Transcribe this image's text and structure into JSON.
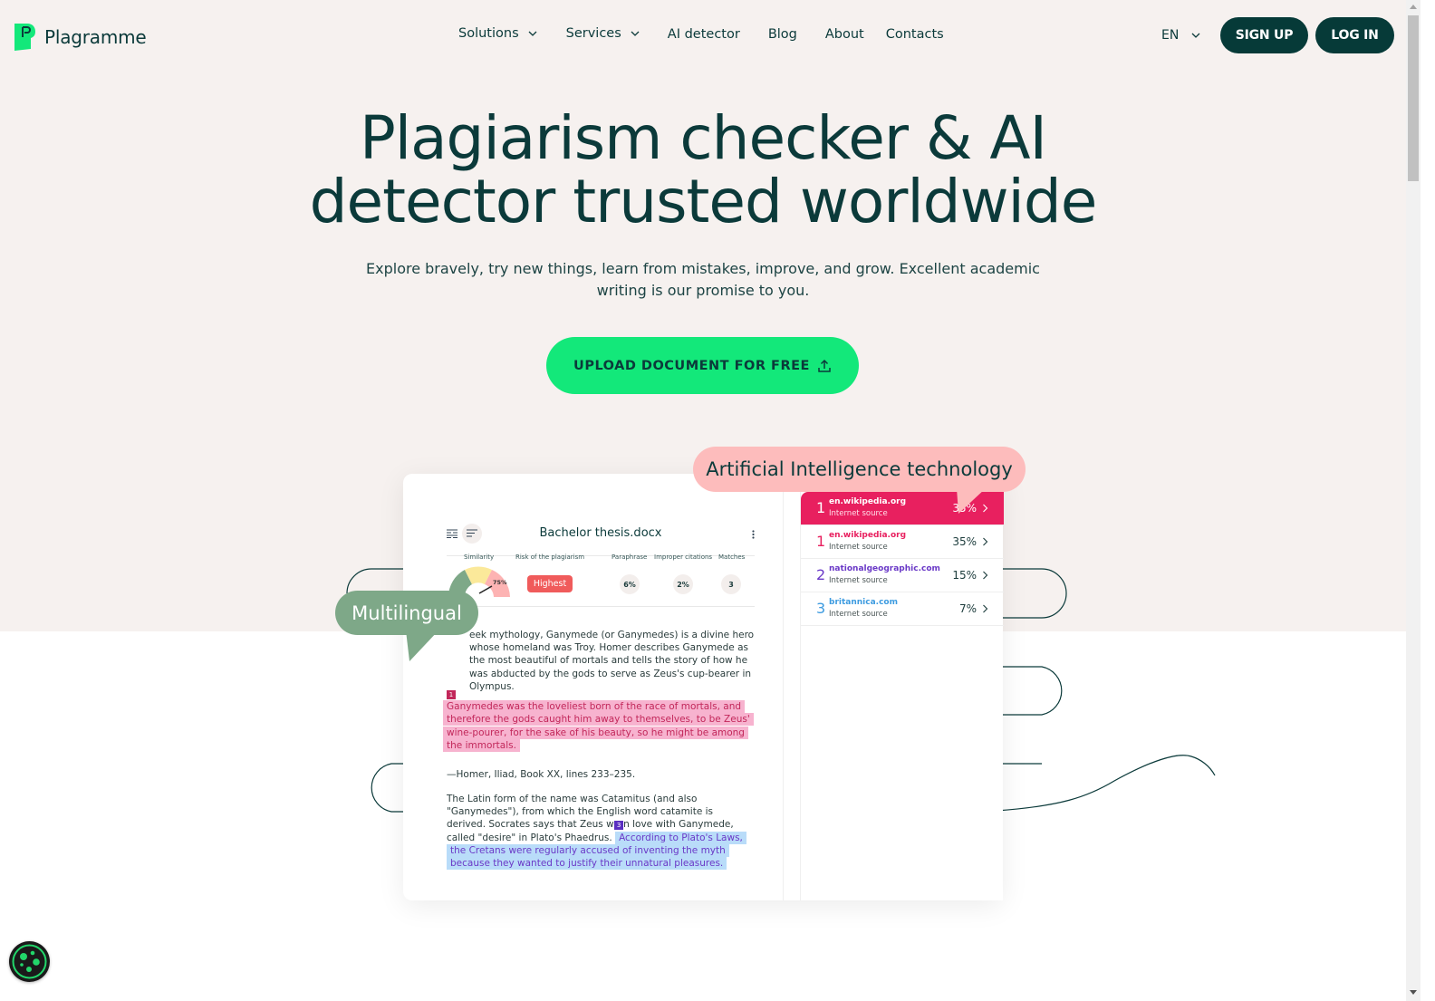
{
  "brand": {
    "name": "Plagramme",
    "accent": "#13e87a",
    "dark": "#063a38"
  },
  "nav": {
    "items": [
      {
        "label": "Solutions",
        "dropdown": true
      },
      {
        "label": "Services",
        "dropdown": true
      },
      {
        "label": "AI detector",
        "dropdown": false
      },
      {
        "label": "Blog",
        "dropdown": false
      },
      {
        "label": "About",
        "dropdown": false
      },
      {
        "label": "Contacts",
        "dropdown": false
      }
    ],
    "language": "EN",
    "signup_label": "SIGN UP",
    "login_label": "LOG IN"
  },
  "hero": {
    "title_line1": "Plagiarism checker & AI",
    "title_line2": "detector trusted worldwide",
    "subtitle": "Explore bravely, try new things, learn from mistakes, improve, and grow. Excellent academic writing is our promise to you.",
    "cta_label": "UPLOAD DOCUMENT FOR FREE",
    "cta_icon": "upload-icon"
  },
  "bubbles": {
    "ai": "Artificial Intelligence technology",
    "multilingual": "Multilingual"
  },
  "report": {
    "doc_title": "Bachelor thesis.docx",
    "stats": {
      "similarity_label": "Similarity",
      "similarity_value": "75%",
      "similarity_fraction": 0.75,
      "risk_label": "Risk of the plagiarism",
      "risk_value": "Highest",
      "paraphrase_label": "Paraphrase",
      "paraphrase_value": "6%",
      "improper_label": "Improper citations",
      "improper_value": "2%",
      "matches_label": "Matches",
      "matches_value": "3"
    },
    "paragraphs": {
      "p1": "eek mythology, Ganymede (or Ganymedes) is a divine hero whose homeland was Troy. Homer describes Ganymede as the most beautiful of mortals and tells the story of how he was abducted by the gods to serve as Zeus's cup-bearer in Olympus.",
      "tag1": "1",
      "quote": "Ganymedes was the loveliest born of the race of mortals, and therefore the gods caught him away to themselves, to be Zeus' wine-pourer, for the sake of his beauty, so he might be among the immortals.",
      "cite": "—Homer, Iliad, Book XX, lines 233–235.",
      "p3a": "The Latin form of the name was Catamitus (and also \"Ganymedes\"), from which the English word catamite is derived. Socrates says that Zeus wa",
      "tag3": "3",
      "p3b": "n love with Ganymede, called \"desire\" in Plato's Phaedrus.",
      "p3_highlight": "According to Plato's Laws, the Cretans were regularly accused of inventing the myth because they wanted to justify their unnatural pleasures."
    },
    "sources": [
      {
        "num": "1",
        "domain": "en.wikipedia.org",
        "type": "Internet source",
        "pct": "35%",
        "active": true,
        "color": "#e8205f"
      },
      {
        "num": "1",
        "domain": "en.wikipedia.org",
        "type": "Internet source",
        "pct": "35%",
        "active": false,
        "color": "#e8205f"
      },
      {
        "num": "2",
        "domain": "nationalgeographic.com",
        "type": "Internet source",
        "pct": "15%",
        "active": false,
        "color": "#6a39c7"
      },
      {
        "num": "3",
        "domain": "britannica.com",
        "type": "Internet source",
        "pct": "7%",
        "active": false,
        "color": "#3d9be0"
      }
    ]
  },
  "cookie_button": "cookie-settings-icon"
}
